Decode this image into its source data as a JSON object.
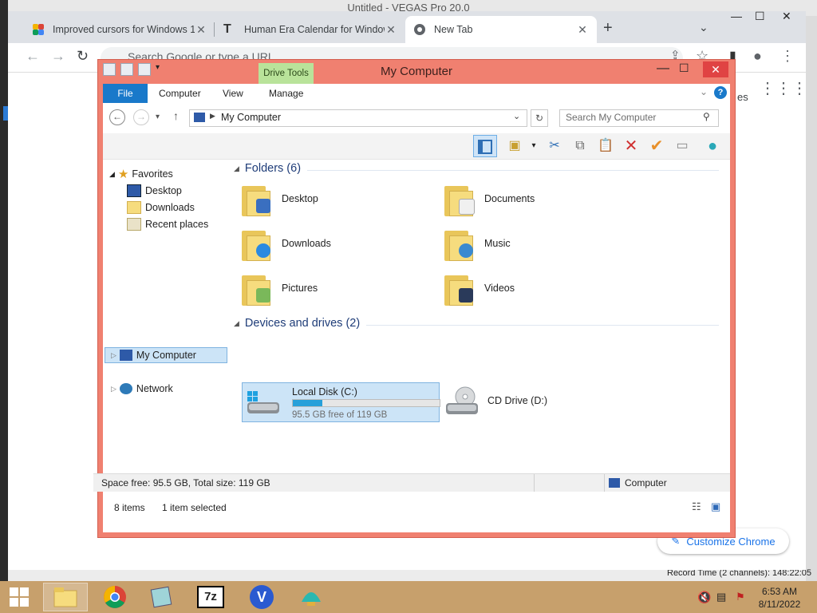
{
  "vegas": {
    "title": "Untitled - VEGAS Pro 20.0",
    "record_time": "Record Time (2 channels): 148:22:05"
  },
  "chrome": {
    "tabs": [
      {
        "label": "Improved cursors for Windows 1",
        "icon": "colorful-app-icon"
      },
      {
        "label": "Human Era Calendar for Window",
        "icon": "t-letter-icon"
      },
      {
        "label": "New Tab",
        "icon": "chrome-icon"
      }
    ],
    "omnibox_placeholder": "Search Google or type a URL",
    "partial_text": "es",
    "customize_label": "Customize Chrome"
  },
  "explorer": {
    "title": "My Computer",
    "contextual_tab": "Drive Tools",
    "ribbon_tabs": [
      "File",
      "Computer",
      "View",
      "Manage"
    ],
    "address": "My Computer",
    "search_placeholder": "Search My Computer",
    "nav": {
      "favorites": "Favorites",
      "favorites_items": [
        "Desktop",
        "Downloads",
        "Recent places"
      ],
      "my_computer": "My Computer",
      "network": "Network"
    },
    "folders_header": "Folders (6)",
    "folders": [
      "Desktop",
      "Documents",
      "Downloads",
      "Music",
      "Pictures",
      "Videos"
    ],
    "devices_header": "Devices and drives (2)",
    "drives": [
      {
        "name": "Local Disk (C:)",
        "free": "95.5 GB free of 119 GB",
        "used_fraction": 0.2
      },
      {
        "name": "CD Drive (D:)"
      }
    ],
    "status": {
      "items": "8 items",
      "selected": "1 item selected",
      "space": "Space free: 95.5 GB, Total size: 119 GB",
      "location": "Computer"
    }
  },
  "taskbar": {
    "time": "6:53 AM",
    "date": "8/11/2022"
  },
  "colors": {
    "explorer_frame": "#f08070",
    "accent": "#1979ca",
    "taskbar": "#c7a06c",
    "selection": "#cce4f7"
  }
}
